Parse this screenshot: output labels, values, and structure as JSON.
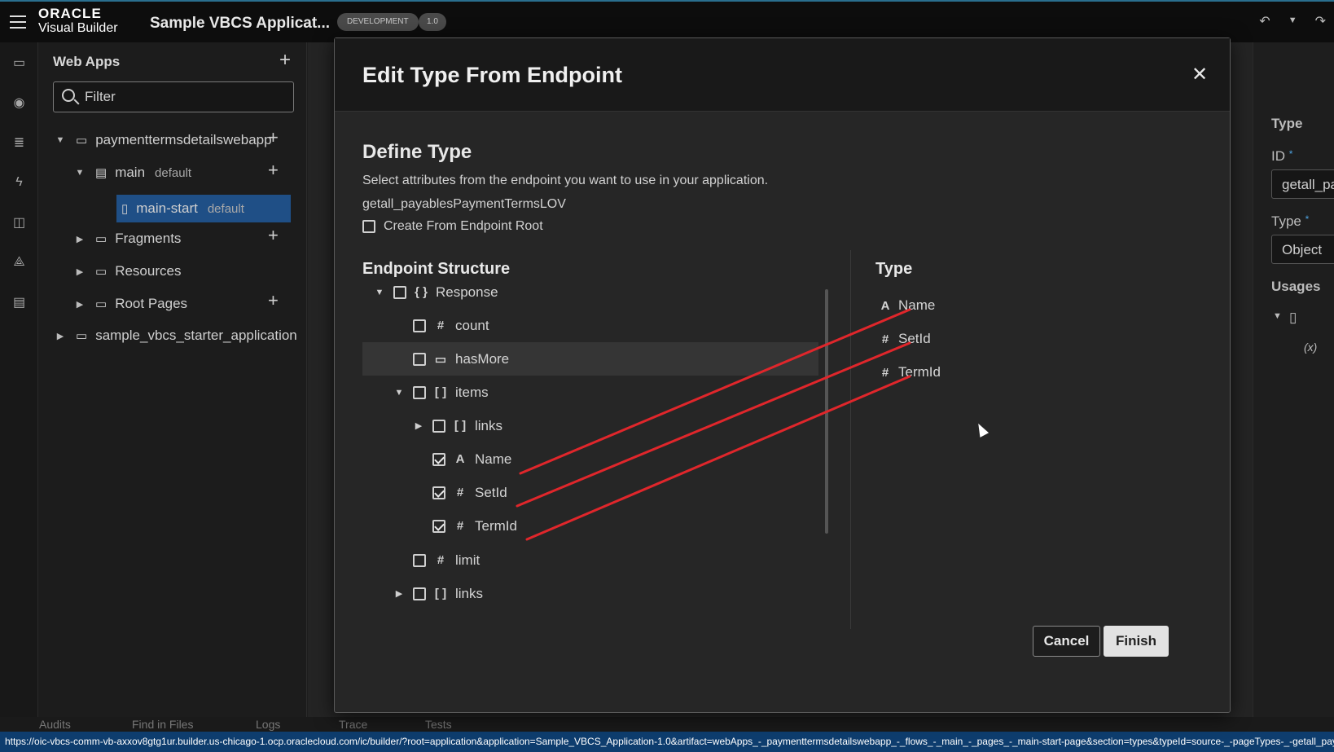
{
  "header": {
    "logo_line1": "ORACLE",
    "logo_line2": "Visual Builder",
    "app_title": "Sample VBCS Applicat...",
    "env_badge": "DEVELOPMENT",
    "version_badge": "1.0"
  },
  "navigator": {
    "title": "Web Apps",
    "filter_placeholder": "Filter",
    "tree": [
      {
        "label": "paymenttermsdetailswebapp",
        "sub": ""
      },
      {
        "label": "main",
        "sub": "default"
      },
      {
        "label": "main-start",
        "sub": "default"
      },
      {
        "label": "Fragments",
        "sub": ""
      },
      {
        "label": "Resources",
        "sub": ""
      },
      {
        "label": "Root Pages",
        "sub": ""
      },
      {
        "label": "sample_vbcs_starter_application",
        "sub": ""
      }
    ]
  },
  "properties": {
    "section_title": "Type",
    "id_label": "ID",
    "id_value": "getall_pa",
    "type_label": "Type",
    "type_value": "Object",
    "usages_label": "Usages",
    "usage_marker": "(x)"
  },
  "modal": {
    "title": "Edit Type From Endpoint",
    "section_title": "Define Type",
    "description": "Select attributes from the endpoint you want to use in your application.",
    "endpoint_name": "getall_payablesPaymentTermsLOV",
    "create_from_root_label": "Create From Endpoint Root",
    "endpoint_structure_title": "Endpoint Structure",
    "type_title": "Type",
    "endpoint_tree": [
      {
        "label": "Response",
        "icon": "{ }",
        "checked": false
      },
      {
        "label": "count",
        "icon": "#",
        "checked": false
      },
      {
        "label": "hasMore",
        "icon": "▭",
        "checked": false
      },
      {
        "label": "items",
        "icon": "[ ]",
        "checked": false
      },
      {
        "label": "links",
        "icon": "[ ]",
        "checked": false
      },
      {
        "label": "Name",
        "icon": "A",
        "checked": true
      },
      {
        "label": "SetId",
        "icon": "#",
        "checked": true
      },
      {
        "label": "TermId",
        "icon": "#",
        "checked": true
      },
      {
        "label": "limit",
        "icon": "#",
        "checked": false
      },
      {
        "label": "links",
        "icon": "[ ]",
        "checked": false
      }
    ],
    "type_fields": [
      {
        "label": "Name",
        "icon": "A"
      },
      {
        "label": "SetId",
        "icon": "#"
      },
      {
        "label": "TermId",
        "icon": "#"
      }
    ],
    "cancel_label": "Cancel",
    "finish_label": "Finish",
    "connector_color": "#e0262b"
  },
  "bottom_tabs": [
    "Audits",
    "Find in Files",
    "Logs",
    "Trace",
    "Tests"
  ],
  "status_url": "https://oic-vbcs-comm-vb-axxov8gtg1ur.builder.us-chicago-1.ocp.oraclecloud.com/ic/builder/?root=application&application=Sample_VBCS_Application-1.0&artifact=webApps_-_paymenttermsdetailswebapp_-_flows_-_main_-_pages_-_main-start-page&section=types&typeId=source-_-pageTypes-_-getall_pay"
}
